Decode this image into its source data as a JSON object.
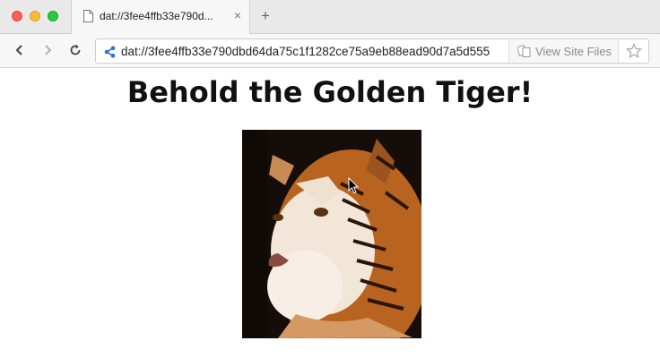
{
  "window": {
    "tab_title": "dat://3fee4ffb33e790d...",
    "tab_close": "×",
    "new_tab": "+"
  },
  "nav": {
    "back_icon": "chevron-left-icon",
    "forward_icon": "chevron-right-icon",
    "reload_icon": "reload-icon"
  },
  "address_bar": {
    "url": "dat://3fee4ffb33e790dbd64da75c1f1282ce75a9eb88ead90d7a5d555",
    "view_site_files": "View Site Files",
    "share_color": "#2a72d6"
  },
  "page": {
    "heading": "Behold the Golden Tiger!"
  }
}
